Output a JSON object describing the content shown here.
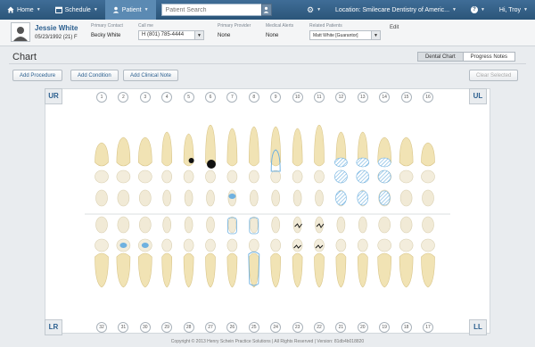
{
  "nav": {
    "home": "Home",
    "schedule": "Schedule",
    "patient": "Patient",
    "search_placeholder": "Patient Search",
    "location": "Location: Smilecare Dentistry of Americ...",
    "user": "Hi, Troy",
    "icons": [
      "home-icon",
      "calendar-icon",
      "user-icon",
      "search-icon",
      "gear-icon",
      "help-icon",
      "person-icon"
    ]
  },
  "patient": {
    "name": "Jessie White",
    "dob": "05/23/1992 (21) F",
    "primary_contact_label": "Primary Contact",
    "primary_contact": "Becky White",
    "call_me_label": "Call me",
    "call_me": "H (801) 785-4444",
    "primary_provider_label": "Primary Provider",
    "primary_provider": "None",
    "medical_alerts_label": "Medical Alerts",
    "medical_alerts": "None",
    "related_patients_label": "Related Patients",
    "related_patients": "Matt White [Guarantor]",
    "edit": "Edit"
  },
  "chart": {
    "title": "Chart",
    "tabs": [
      "Dental Chart",
      "Progress Notes"
    ],
    "active_tab": "Dental Chart",
    "buttons": {
      "add_procedure": "Add Procedure",
      "add_condition": "Add Condition",
      "add_clinical_note": "Add Clinical Note",
      "clear_selected": "Clear Selected"
    },
    "quadrants": {
      "ur": "UR",
      "ul": "UL",
      "lr": "LR",
      "ll": "LL"
    },
    "upper_numbers": [
      "1",
      "2",
      "3",
      "4",
      "5",
      "6",
      "7",
      "8",
      "9",
      "10",
      "11",
      "12",
      "13",
      "14",
      "15",
      "16"
    ],
    "lower_numbers": [
      "32",
      "31",
      "30",
      "29",
      "28",
      "27",
      "26",
      "25",
      "24",
      "23",
      "22",
      "21",
      "20",
      "19",
      "18",
      "17"
    ]
  },
  "footer": "Copyright © 2013 Henry Schein Practice Solutions | All Rights Reserved | Version: 81db4b018820",
  "colors": {
    "nav": "#2b5579",
    "accent": "#2b5f8f",
    "condition_blue": "#6fb1e0",
    "decay_black": "#111111"
  }
}
